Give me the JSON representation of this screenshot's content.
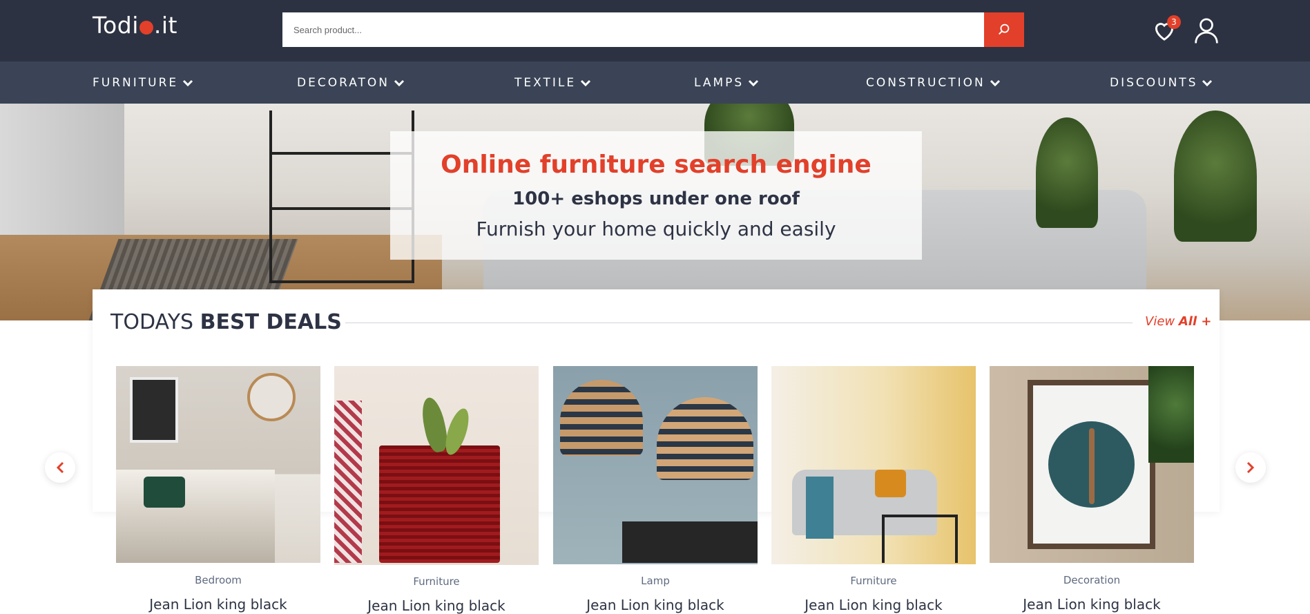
{
  "header": {
    "logo_text_left": "Todi",
    "logo_text_right": ".it",
    "search_placeholder": "Search product...",
    "wishlist_count": "3",
    "icons": {
      "search": "search-icon",
      "wishlist": "heart-icon",
      "account": "user-icon"
    }
  },
  "nav": {
    "items": [
      {
        "label": "FURNITURE"
      },
      {
        "label": "DECORATON"
      },
      {
        "label": "TEXTILE"
      },
      {
        "label": "LAMPS"
      },
      {
        "label": "CONSTRUCTION"
      },
      {
        "label": "DISCOUNTS"
      }
    ]
  },
  "hero": {
    "title": "Online furniture search engine",
    "subtitle": "100+ eshops under one roof",
    "tagline": "Furnish your home quickly and easily"
  },
  "deals": {
    "heading_light": "TODAYS ",
    "heading_bold": "BEST DEALS",
    "view_all_light": "View ",
    "view_all_bold": "All +",
    "products": [
      {
        "category": "Bedroom",
        "name": "Jean Lion king black"
      },
      {
        "category": "Furniture",
        "name": "Jean Lion king black"
      },
      {
        "category": "Lamp",
        "name": "Jean Lion king black"
      },
      {
        "category": "Furniture",
        "name": "Jean Lion king black"
      },
      {
        "category": "Decoration",
        "name": "Jean Lion king black"
      }
    ]
  },
  "colors": {
    "header_bg": "#2c3241",
    "nav_bg": "#3a4456",
    "accent": "#e2402a",
    "text_dark": "#2d3344"
  }
}
